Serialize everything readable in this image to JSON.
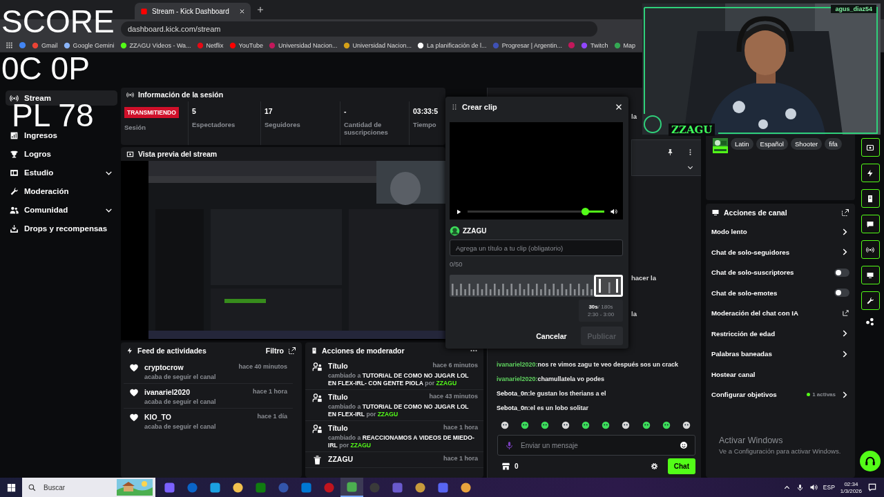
{
  "overlay": {
    "lines": [
      "SCORE",
      "0C 0P",
      "PL 78"
    ]
  },
  "browser": {
    "tabs": [
      {
        "label": "Stream - Kick Dashboard",
        "selected": true
      }
    ],
    "address": "dashboard.kick.com/stream",
    "bookmarks": [
      {
        "kind": "icon"
      },
      {
        "kind": "link",
        "label": "Gmail"
      },
      {
        "kind": "link",
        "label": "Google Gemini"
      },
      {
        "kind": "link",
        "label": "ZZAGU Videos - Wa..."
      },
      {
        "kind": "link",
        "label": "Netflix"
      },
      {
        "kind": "link",
        "label": "YouTube"
      },
      {
        "kind": "link",
        "label": "Universidad Nacion..."
      },
      {
        "kind": "link",
        "label": "Universidad Nacion..."
      },
      {
        "kind": "link",
        "label": "La planificación de l..."
      },
      {
        "kind": "link",
        "label": "Progresar | Argentin..."
      },
      {
        "kind": "icon"
      },
      {
        "kind": "link",
        "label": "Twitch"
      },
      {
        "kind": "link",
        "label": "Map"
      }
    ]
  },
  "sidebar": {
    "items": [
      {
        "kind": "link",
        "label": "Stream",
        "selected": true
      },
      {
        "kind": "link",
        "label": "Ingresos",
        "selected": false
      },
      {
        "kind": "link",
        "label": "Logros",
        "selected": false
      },
      {
        "kind": "group",
        "label": "Estudio",
        "selected": false,
        "expanded": false
      },
      {
        "kind": "link",
        "label": "Moderación",
        "selected": false
      },
      {
        "kind": "group",
        "label": "Comunidad",
        "selected": false,
        "expanded": false
      },
      {
        "kind": "link",
        "label": "Drops y recompensas",
        "selected": false
      }
    ]
  },
  "session": {
    "title": "Información de la sesión",
    "status": "TRANSMITIENDO",
    "status_label": "Sesión",
    "stats": [
      {
        "value": "5",
        "label": "Espectadores"
      },
      {
        "value": "17",
        "label": "Seguidores"
      },
      {
        "value": "-",
        "label": "Cantidad de suscripciones"
      },
      {
        "value": "03:33:5",
        "label": "Tiempo"
      }
    ]
  },
  "preview": {
    "title": "Vista previa del stream"
  },
  "feed": {
    "title": "Feed de actividades",
    "filter": "Filtro",
    "items": [
      {
        "name": "cryptocrow",
        "action": "acaba de seguir el canal",
        "time": "hace 40 minutos"
      },
      {
        "name": "ivanariel2020",
        "action": "acaba de seguir el canal",
        "time": "hace 1 hora"
      },
      {
        "name": "KIO_TO",
        "action": "acaba de seguir el canal",
        "time": "hace 1 día"
      }
    ]
  },
  "mod_actions": {
    "title": "Acciones de moderador",
    "items": [
      {
        "kind": "title",
        "label": "Título",
        "time": "hace 6 minutos",
        "prefix": "cambiado a",
        "value": "TUTORIAL DE COMO NO JUGAR LOL EN FLEX-IRL- CON GENTE PIOLA",
        "by": "por",
        "user": "ZZAGU"
      },
      {
        "kind": "title",
        "label": "Título",
        "time": "hace 43 minutos",
        "prefix": "cambiado a",
        "value": "TUTORIAL DE COMO NO JUGAR LOL EN FLEX-IRL",
        "by": "por",
        "user": "ZZAGU"
      },
      {
        "kind": "title",
        "label": "Título",
        "time": "hace 1 hora",
        "prefix": "cambiado a",
        "value": "REACCIONAMOS A VIDEOS DE MIEDO-IRL",
        "by": "por",
        "user": "ZZAGU"
      },
      {
        "kind": "delete",
        "label": "ZZAGU",
        "time": "hace 1 hora"
      }
    ]
  },
  "chat": {
    "fragments": [
      "la",
      "hacer la",
      "la"
    ],
    "messages": [
      {
        "user": "ivanariel2020:",
        "color": "#5fd35f",
        "text": "nos re vimos zagu te veo después sos un crack"
      },
      {
        "user": "ivanariel2020:",
        "color": "#5fd35f",
        "text": "chamullatela vo podes"
      },
      {
        "user": "Sebota_0n:",
        "color": "#ffffff",
        "text": "le gustan los therians a el"
      },
      {
        "user": "Sebota_0n:",
        "color": "#ffffff",
        "text": "el es un lobo solitar"
      }
    ],
    "input": {
      "placeholder": "Enviar un mensaje"
    },
    "points": "0",
    "send": "Chat"
  },
  "channel_info": {
    "tags": [
      "Latin",
      "Español",
      "Shooter",
      "fifa"
    ]
  },
  "channel_actions": {
    "title": "Acciones de canal",
    "items": [
      {
        "kind": "arrow",
        "label": "Modo lento"
      },
      {
        "kind": "arrow",
        "label": "Chat de solo-seguidores"
      },
      {
        "kind": "toggle",
        "label": "Chat de solo-suscriptores",
        "on": false
      },
      {
        "kind": "toggle",
        "label": "Chat de solo-emotes",
        "on": false
      },
      {
        "kind": "external",
        "label": "Moderación del chat con IA"
      },
      {
        "kind": "arrow",
        "label": "Restricción de edad"
      },
      {
        "kind": "arrow",
        "label": "Palabras baneadas"
      },
      {
        "kind": "plain",
        "label": "Hostear canal"
      },
      {
        "kind": "goal",
        "label": "Configurar objetivos",
        "badge": "1 activas"
      }
    ]
  },
  "clip_modal": {
    "title": "Crear clip",
    "playback": {
      "level": 0.86
    },
    "channel": "ZZAGU",
    "title_field": {
      "placeholder": "Agrega un título a tu clip (obligatorio)"
    },
    "counter": "0/50",
    "selection": {
      "duration": "30s",
      "total": "/ 180s",
      "range": "2:30 - 3:00"
    },
    "buttons": [
      {
        "kind": "plain",
        "label": "Cancelar",
        "disabled": false
      },
      {
        "kind": "filled",
        "label": "Publicar",
        "disabled": true
      }
    ]
  },
  "webcam": {
    "username": "agus_diaz54",
    "label": "ZZAGU"
  },
  "windows_notice": {
    "title": "Activar Windows",
    "text": "Ve a Configuración para activar Windows."
  },
  "taskbar": {
    "search": {
      "placeholder": "Buscar"
    },
    "apps": [
      {
        "selected": false
      },
      {
        "selected": false
      },
      {
        "selected": false
      },
      {
        "selected": false
      },
      {
        "selected": false
      },
      {
        "selected": false
      },
      {
        "selected": false
      },
      {
        "selected": false
      },
      {
        "selected": true
      },
      {
        "selected": false
      },
      {
        "selected": false
      },
      {
        "selected": false
      },
      {
        "selected": false
      },
      {
        "selected": false
      }
    ],
    "language": "ESP",
    "time": "02:34",
    "date": "1/3/2026"
  }
}
